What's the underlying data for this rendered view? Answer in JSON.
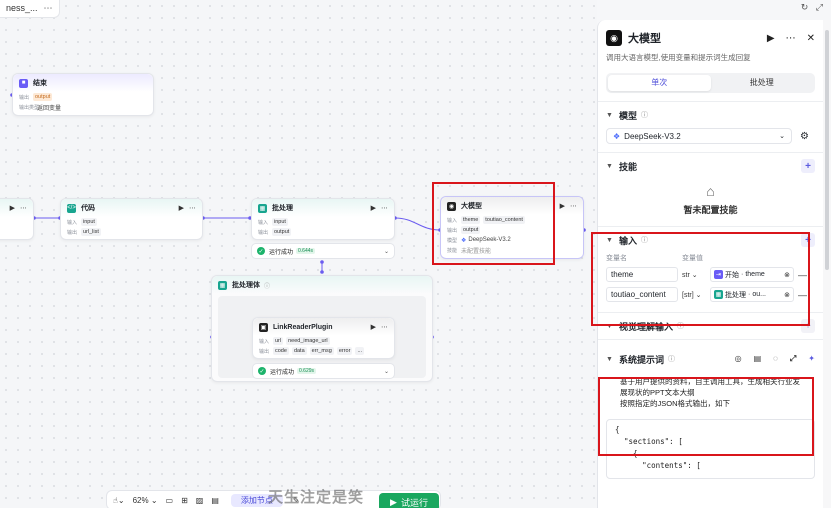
{
  "tab_title": "ness_...",
  "canvas": {
    "end_node": {
      "title": "结束",
      "output_label": "输出",
      "output_tag": "output",
      "type_label": "输出类型",
      "type_value": "返回变量"
    },
    "code_node": {
      "title": "代码",
      "in_label": "输入",
      "in_tag": "input",
      "out_label": "输出",
      "out_tag": "url_list"
    },
    "batch_node": {
      "title": "批处理",
      "in_label": "输入",
      "in_tag": "input",
      "out_label": "输出",
      "out_tag": "output",
      "status": "运行成功",
      "time": "0.644s"
    },
    "llm_node": {
      "title": "大模型",
      "in_label": "输入",
      "in_tag1": "theme",
      "in_tag2": "toutiao_content",
      "out_label": "输出",
      "out_tag": "output",
      "model_label": "模型",
      "model_value": "DeepSeek-V3.2",
      "skill_label": "技能",
      "skill_value": "未配置技能"
    },
    "batch_body": {
      "title": "批处理体"
    },
    "plugin_node": {
      "title": "LinkReaderPlugin",
      "in_label": "输入",
      "in_tag1": "url",
      "in_tag2": "need_image_url",
      "out_label": "输出",
      "out_tag1": "code",
      "out_tag2": "data",
      "out_tag3": "err_msg",
      "out_tag4": "error",
      "more": "...",
      "status": "运行成功",
      "time": "0.629s"
    }
  },
  "toolbar": {
    "zoom": "62%",
    "add_node": "添加节点",
    "run": "试运行"
  },
  "watermark": "天生注定是笑",
  "panel": {
    "title": "大模型",
    "description": "调用大语言模型,使用变量和提示词生成回复",
    "tabs": [
      "单次",
      "批处理"
    ],
    "model_section": "模型",
    "model_value": "DeepSeek-V3.2",
    "skills_section": "技能",
    "skills_empty": "暂未配置技能",
    "input_section": "输入",
    "col_name": "变量名",
    "col_value": "变量值",
    "inputs": [
      {
        "name": "theme",
        "type": "str",
        "source": "开始",
        "var": "theme"
      },
      {
        "name": "toutiao_content",
        "type": "[str]",
        "source": "批处理",
        "var": "ou..."
      }
    ],
    "vision_section": "视觉理解输入",
    "prompt_section": "系统提示词",
    "prompt_text": "基于用户提供的资料，自主调用工具，生成相关行业发展现状的PPT文本大纲\n按照指定的JSON格式输出，如下",
    "code_text": "{\n  \"sections\": [\n    {\n      \"contents\": ["
  }
}
